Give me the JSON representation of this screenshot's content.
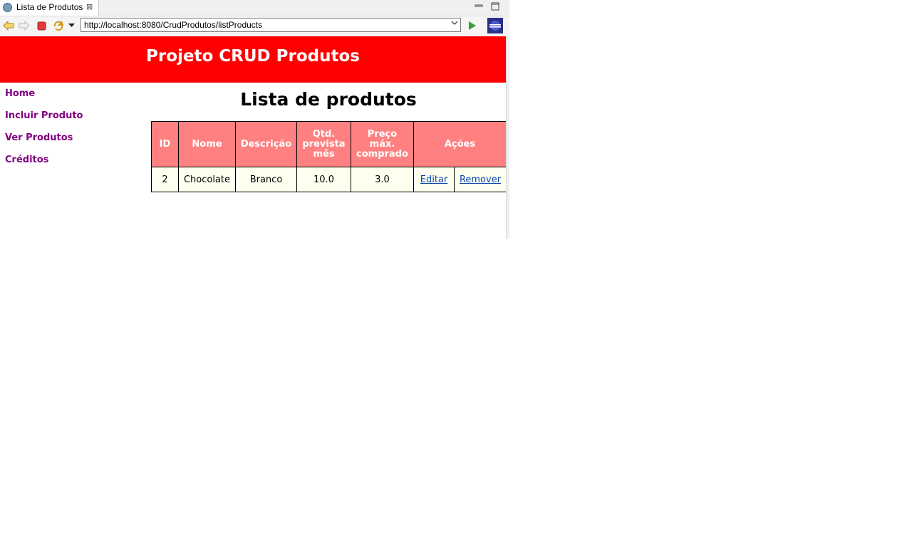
{
  "browser": {
    "tab_title": "Lista de Produtos",
    "url": "http://localhost:8080/CrudProdutos/listProducts"
  },
  "header": {
    "title": "Projeto CRUD Produtos"
  },
  "nav": {
    "items": [
      "Home",
      "Incluir Produto",
      "Ver Produtos",
      "Créditos"
    ]
  },
  "main": {
    "title": "Lista de produtos",
    "table": {
      "headers": {
        "id": "ID",
        "nome": "Nome",
        "descricao": "Descrição",
        "qtd": [
          "Qtd.",
          "prevista",
          "mês"
        ],
        "preco": [
          "Preço",
          "máx.",
          "comprado"
        ],
        "acoes": "Ações"
      },
      "rows": [
        {
          "id": "2",
          "nome": "Chocolate",
          "descricao": "Branco",
          "qtd": "10.0",
          "preco": "3.0",
          "editar": "Editar",
          "remover": "Remover"
        }
      ]
    }
  },
  "colors": {
    "header_bg": "#ff0000",
    "th_bg": "#ff8080",
    "td_bg": "#fffff0",
    "nav_link": "#800080"
  }
}
